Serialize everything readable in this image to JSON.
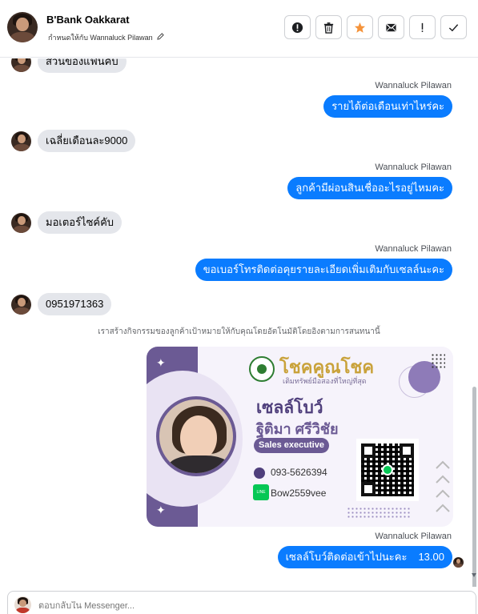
{
  "header": {
    "name": "B'Bank Oakkarat",
    "assigned_to": "กำหนดให้กับ Wannaluck Pilawan",
    "actions": [
      {
        "name": "report-icon",
        "glyph": "!"
      },
      {
        "name": "trash-icon",
        "glyph": "trash"
      },
      {
        "name": "star-icon",
        "glyph": "star",
        "color": "#f5933a"
      },
      {
        "name": "mail-icon",
        "glyph": "mail"
      },
      {
        "name": "alert-icon",
        "glyph": "!"
      },
      {
        "name": "check-icon",
        "glyph": "check"
      }
    ]
  },
  "messages": [
    {
      "type": "in",
      "text": "ส่วนของแฟนคับ"
    },
    {
      "type": "out",
      "sender": "Wannaluck Pilawan",
      "text": "รายได้ต่อเดือนเท่าไหร่คะ"
    },
    {
      "type": "in",
      "text": "เฉลี่ยเดือนละ9000"
    },
    {
      "type": "out",
      "sender": "Wannaluck Pilawan",
      "text": "ลูกค้ามีผ่อนสินเชื่ออะไรอยู่ไหมคะ"
    },
    {
      "type": "in",
      "text": "มอเตอร์ไซค์คับ"
    },
    {
      "type": "out",
      "sender": "Wannaluck Pilawan",
      "text": "ขอเบอร์โทรติดต่อคุยรายละเอียดเพิ่มเติมกับเซลล์นะคะ"
    },
    {
      "type": "in",
      "text": "0951971363"
    },
    {
      "type": "system",
      "text": "เราสร้างกิจกรรมของลูกค้าเป้าหมายให้กับคุณโดยอัตโนมัติโดยอิงตามการสนทนานี้"
    },
    {
      "type": "out",
      "sender": "Wannaluck Pilawan",
      "text": "เซลล์โบว์ติดต่อเข้าไปนะคะ",
      "time": "13.00"
    }
  ],
  "card": {
    "brand": "โชคคูณโชค",
    "tagline": "เติมทรัพย์มือสองที่ใหญ่ที่สุด",
    "title": "เซลล์โบว์",
    "person": "ฐิติมา ศรีวิชัย",
    "role": "Sales executive",
    "phone": "093-5626394",
    "line_icon": "LINE",
    "line_id": "Bow2559vee",
    "accent": "#6b5a94",
    "brand_color": "#c9a23a"
  },
  "composer": {
    "placeholder": "ตอบกลับใน Messenger..."
  },
  "colors": {
    "outgoing": "#0a7cff",
    "incoming": "#e4e6eb"
  }
}
